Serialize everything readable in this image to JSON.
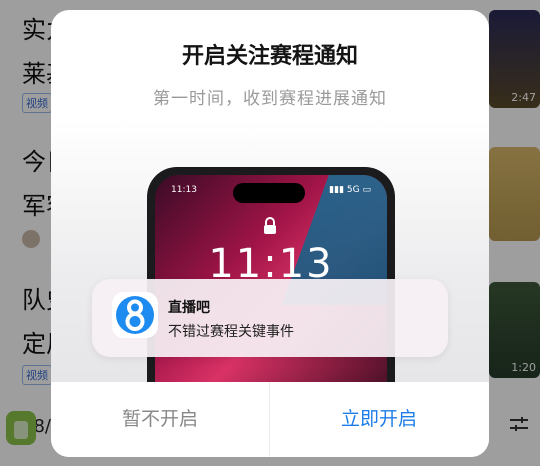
{
  "feed": {
    "items": [
      {
        "title": "实力\n莱基",
        "tag": "视频",
        "duration": "2:47"
      },
      {
        "title": "今日\n军容",
        "tag": "",
        "duration": ""
      },
      {
        "title": "队史\n定风",
        "tag": "视频",
        "duration": "1:20"
      }
    ],
    "bottom_date": "08/"
  },
  "dialog": {
    "title": "开启关注赛程通知",
    "subtitle": "第一时间，收到赛程进展通知",
    "phone": {
      "status_time": "11:13",
      "status_network": "5G",
      "lock_time": "11:13"
    },
    "notification": {
      "app_name": "直播吧",
      "message": "不错过赛程关键事件"
    },
    "buttons": {
      "later": "暂不开启",
      "enable": "立即开启"
    }
  },
  "colors": {
    "accent": "#1c7de9",
    "app_icon_blue": "#1e8bf0"
  }
}
